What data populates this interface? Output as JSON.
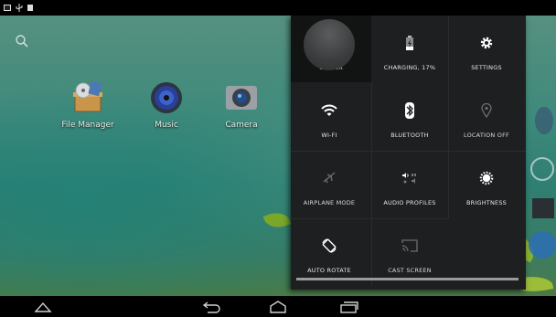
{
  "home": {
    "apps": [
      {
        "label": "File Manager",
        "icon": "file-manager-icon"
      },
      {
        "label": "Music",
        "icon": "music-speaker-icon"
      },
      {
        "label": "Camera",
        "icon": "camera-icon"
      }
    ]
  },
  "quick_settings": {
    "tiles": [
      {
        "label": "OWNER",
        "icon": "user-avatar"
      },
      {
        "label": "CHARGING, 17%",
        "icon": "battery-charging-icon"
      },
      {
        "label": "SETTINGS",
        "icon": "gear-icon"
      },
      {
        "label": "WI-FI",
        "icon": "wifi-icon"
      },
      {
        "label": "BLUETOOTH",
        "icon": "bluetooth-icon"
      },
      {
        "label": "LOCATION OFF",
        "icon": "location-pin-icon"
      },
      {
        "label": "AIRPLANE MODE",
        "icon": "airplane-icon"
      },
      {
        "label": "AUDIO PROFILES",
        "icon": "audio-profiles-icon"
      },
      {
        "label": "BRIGHTNESS",
        "icon": "brightness-icon"
      },
      {
        "label": "AUTO ROTATE",
        "icon": "auto-rotate-icon"
      },
      {
        "label": "CAST SCREEN",
        "icon": "cast-icon"
      }
    ],
    "battery_level_percent": 17
  },
  "colors": {
    "panel_bg": "#1e1f20",
    "panel_text": "#e6e6e6",
    "icon_active": "#ffffff",
    "icon_inactive": "#6b6d6f"
  },
  "navigation": {
    "buttons": [
      "up-icon",
      "back-icon",
      "home-icon",
      "recents-icon"
    ]
  }
}
